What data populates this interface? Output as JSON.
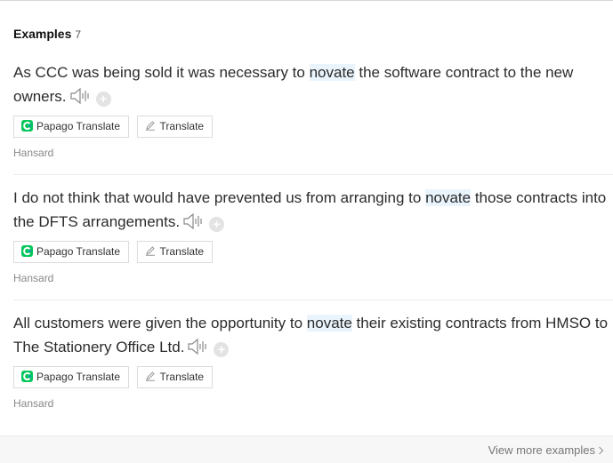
{
  "section": {
    "title": "Examples",
    "count": "7"
  },
  "examples": [
    {
      "before": "As CCC was being sold it was necessary to ",
      "term": "novate",
      "after": " the software contract to the new owners.",
      "papago_label": "Papago Translate",
      "translate_label": "Translate",
      "source": "Hansard"
    },
    {
      "before": "I do not think that would have prevented us from arranging to ",
      "term": "novate",
      "after": " those contracts into the DFTS arrangements.",
      "papago_label": "Papago Translate",
      "translate_label": "Translate",
      "source": "Hansard"
    },
    {
      "before": "All customers were given the opportunity to ",
      "term": "novate",
      "after": " their existing contracts from HMSO to The Stationery Office Ltd.",
      "papago_label": "Papago Translate",
      "translate_label": "Translate",
      "source": "Hansard"
    }
  ],
  "footer": {
    "more_label": "View more examples"
  },
  "colors": {
    "highlight": "#eaf4fc",
    "papago_green": "#03c75a",
    "papago_blue": "#1e8bd6"
  },
  "icons": {
    "speaker": "speaker-icon",
    "add": "plus-icon",
    "papago": "papago-icon",
    "translate": "pen-icon",
    "more": "chevron-right-icon"
  }
}
